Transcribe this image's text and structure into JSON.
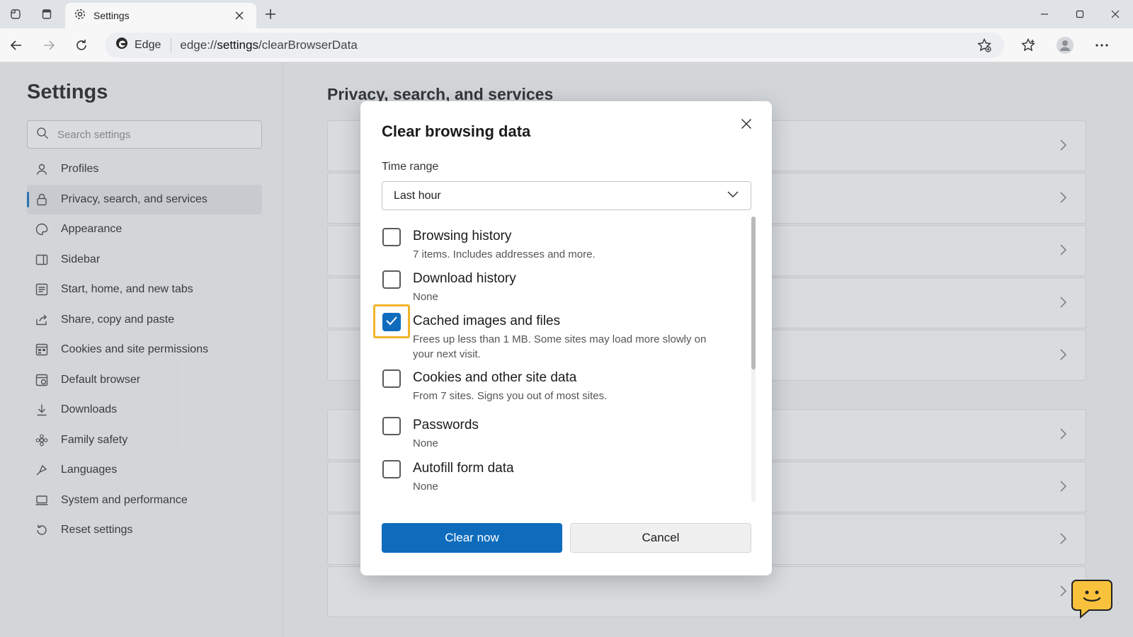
{
  "browser": {
    "tab_title": "Settings",
    "address": {
      "chip_label": "Edge",
      "url_scheme": "edge://",
      "url_host": "settings",
      "url_path": "/clearBrowserData"
    }
  },
  "sidebar": {
    "title": "Settings",
    "search_placeholder": "Search settings",
    "items": [
      {
        "label": "Profiles",
        "icon": "profile-icon"
      },
      {
        "label": "Privacy, search, and services",
        "icon": "lock-icon",
        "active": true
      },
      {
        "label": "Appearance",
        "icon": "appearance-icon"
      },
      {
        "label": "Sidebar",
        "icon": "sidebar-icon"
      },
      {
        "label": "Start, home, and new tabs",
        "icon": "home-tabs-icon"
      },
      {
        "label": "Share, copy and paste",
        "icon": "share-icon"
      },
      {
        "label": "Cookies and site permissions",
        "icon": "cookies-icon"
      },
      {
        "label": "Default browser",
        "icon": "default-browser-icon"
      },
      {
        "label": "Downloads",
        "icon": "download-icon"
      },
      {
        "label": "Family safety",
        "icon": "family-icon"
      },
      {
        "label": "Languages",
        "icon": "languages-icon"
      },
      {
        "label": "System and performance",
        "icon": "system-icon"
      },
      {
        "label": "Reset settings",
        "icon": "reset-icon"
      }
    ]
  },
  "content": {
    "title": "Privacy, search, and services"
  },
  "dialog": {
    "title": "Clear browsing data",
    "time_range_label": "Time range",
    "time_range_value": "Last hour",
    "options": [
      {
        "label": "Browsing history",
        "description": "7 items. Includes addresses and more.",
        "checked": false
      },
      {
        "label": "Download history",
        "description": "None",
        "checked": false
      },
      {
        "label": "Cached images and files",
        "description": "Frees up less than 1 MB. Some sites may load more slowly on your next visit.",
        "checked": true
      },
      {
        "label": "Cookies and other site data",
        "description": "From 7 sites. Signs you out of most sites.",
        "checked": false
      },
      {
        "label": "Passwords",
        "description": "None",
        "checked": false
      },
      {
        "label": "Autofill form data",
        "description": "None",
        "checked": false
      }
    ],
    "primary_button": "Clear now",
    "secondary_button": "Cancel"
  },
  "colors": {
    "accent": "#0f6cbd",
    "focus_ring": "#f0b429",
    "helper_bubble": "#f9c23c"
  }
}
